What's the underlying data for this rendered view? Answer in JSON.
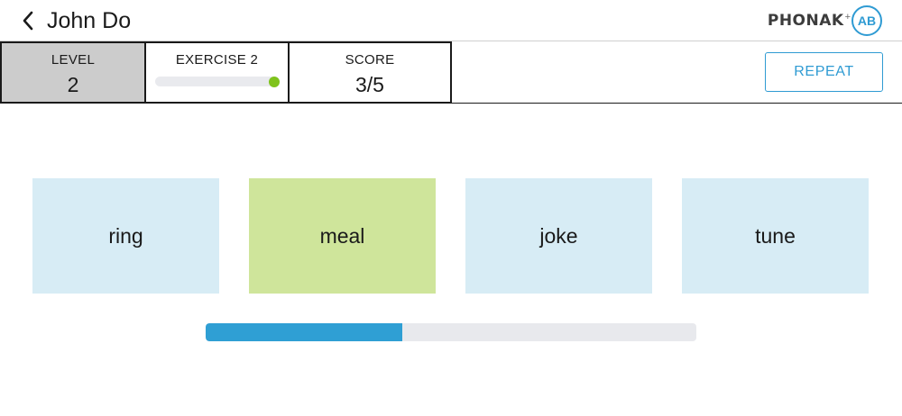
{
  "header": {
    "title": "John Do",
    "back_icon": "chevron-left-icon",
    "logo": {
      "brand": "PHONAK",
      "plus": "+",
      "badge": "AB",
      "badge_color": "#2f9bd3"
    }
  },
  "stats": {
    "level": {
      "label": "LEVEL",
      "value": "2"
    },
    "exercise": {
      "label": "EXERCISE 2",
      "progress": 1.0,
      "indicator_color": "#7fc31c"
    },
    "score": {
      "label": "SCORE",
      "value": "3/5"
    }
  },
  "repeat_button": {
    "label": "REPEAT",
    "color": "#2f9bd3"
  },
  "choices": [
    {
      "word": "ring",
      "selected": false
    },
    {
      "word": "meal",
      "selected": true
    },
    {
      "word": "joke",
      "selected": false
    },
    {
      "word": "tune",
      "selected": false
    }
  ],
  "colors": {
    "card": "#d7ecf5",
    "card_selected": "#cfe59b",
    "progress_fill": "#2f9fd4",
    "progress_track": "#e8e9ed"
  },
  "progress": {
    "fraction": 0.4
  }
}
